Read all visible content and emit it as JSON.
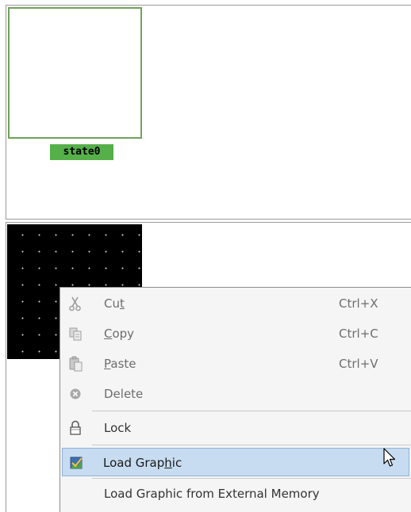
{
  "state_panel": {
    "state_label": "state0"
  },
  "context_menu": {
    "items": [
      {
        "id": "cut",
        "prefix": "Cu",
        "mnemonic": "t",
        "suffix": "",
        "shortcut": "Ctrl+X",
        "icon": "scissors-icon",
        "enabled": false
      },
      {
        "id": "copy",
        "prefix": "",
        "mnemonic": "C",
        "suffix": "opy",
        "shortcut": "Ctrl+C",
        "icon": "copy-icon",
        "enabled": false
      },
      {
        "id": "paste",
        "prefix": "",
        "mnemonic": "P",
        "suffix": "aste",
        "shortcut": "Ctrl+V",
        "icon": "paste-icon",
        "enabled": false
      },
      {
        "id": "delete",
        "prefix": "Delete",
        "mnemonic": "",
        "suffix": "",
        "shortcut": "",
        "icon": "delete-icon",
        "enabled": false
      },
      {
        "id": "lock",
        "prefix": "Lock",
        "mnemonic": "",
        "suffix": "",
        "shortcut": "",
        "icon": "lock-icon",
        "enabled": true
      },
      {
        "id": "load-graphic",
        "prefix": "Load Grap",
        "mnemonic": "h",
        "suffix": "ic",
        "shortcut": "",
        "icon": "load-graphic-icon",
        "enabled": true,
        "highlighted": true
      },
      {
        "id": "load-graphic-external",
        "prefix": "Load Graphic from External Memory",
        "mnemonic": "",
        "suffix": "",
        "shortcut": "",
        "icon": "",
        "enabled": true
      }
    ]
  },
  "colors": {
    "state_border": "#6fa25b",
    "state_label_bg": "#56b04a",
    "canvas_bg": "#000000",
    "menu_bg": "#f5f5f5",
    "menu_highlight": "#c7dcf0"
  }
}
